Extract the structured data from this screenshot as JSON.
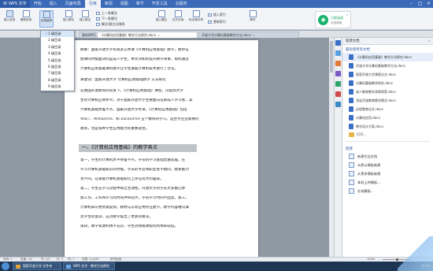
{
  "titlebar": {
    "app_name": "WPS 文字",
    "menus": [
      "开始",
      "插入",
      "页面布局",
      "引用",
      "审阅",
      "视图",
      "章节",
      "开发工具",
      "云服务"
    ],
    "active_menu": "引用"
  },
  "ribbon": {
    "buttons": [
      "插入目录",
      "更新目录",
      "目录级别",
      "插入脚注",
      "插入尾注",
      "插入题注",
      "交叉引用",
      "标记索引项",
      "邮件"
    ],
    "small_items": [
      "上一条脚注",
      "下一条脚注",
      "脚注/尾注分隔线",
      "插入索引",
      "更新索引"
    ],
    "wifi": {
      "title": "已经连接",
      "subtitle": "无线网络"
    }
  },
  "dropdown": {
    "items": [
      "1 级目录",
      "2 级目录",
      "3 级目录",
      "4 级目录",
      "5 级目录",
      "6 级目录",
      "7 级目录",
      "8 级目录",
      "9 级目录"
    ],
    "checked": "1 级目录"
  },
  "tabs": [
    {
      "label": "我的WPS"
    },
    {
      "label": "《计算机应用基础》教学方法探究.docx"
    },
    {
      "label": "开放大学计算机基础教学方法.docx"
    }
  ],
  "document": {
    "lines": [
      "摘要：国家开放大学有很多公共课《计算机应用基础》教学，教师在",
      "授课的时候面对的是成人学生，本文对如何提升教学效果，如何通过",
      "计算机应用基础课的教学让学生掌握计算机技术进行了讨论。",
      "关键词：国家开放大学 计算机应用基础教学 方法探究",
      "在我国开放教育的背景下，《计算机应用基础》课程，以提高大学",
      "生的计算机应用水平。对于国家开放大学主要面向在职成人学习者，其",
      "计算机基础参差不齐。国家开放大学考试，《计算机应用基础》包括",
      "Win7、Word2010、和 Excel2010 五个模块的学习，是合乎企业需要的",
      "教育，也是培养学生应用能力的重要途径。"
    ],
    "heading": "一、《计算机应用基础》的教学难点",
    "lines2": [
      "第一，学生的计算机水平参差不齐。学员的学习基础普遍较差，在",
      "学习计算机基础知识的时候，学员的专业和职业各不相同，接受能力",
      "也不同，在掌握计算机基础知识上存在较大的差异。",
      "第二，学生在学习过程中缺乏主动性。开放大学的学员大多都已参",
      "加工作，工作和学习的时间冲突较大，学员学习时间不固定。第三，",
      "计算机知识更新速度快，教材与实际应用存在脱节，教学内容难以满",
      "足学生的需求，这对教学提出了更高的要求。",
      "第四，教学资源利用不充分，学生对网络课程的利用率较低。"
    ]
  },
  "panel": {
    "title": "新建文档",
    "recent_section": "最近使用的文档",
    "recent_files": [
      "《计算机应用基础》教学方法探究.docx",
      "开放大学计算机基础教学方法.docx",
      "国家开放大学课程论文.docx",
      "计算机基础教学研究.docx",
      "成人教育教学改革探索.docx",
      "浅谈开放教育教学模式.docx",
      "远程教育论文.docx",
      "计算机应用.docx",
      "教学设计方案.docx"
    ],
    "open_label": "打开...",
    "new_section": "新建",
    "new_items": [
      "新建空白文档",
      "从默认模板新建",
      "从更多模板新建",
      "本机上的模板...",
      "在线模板..."
    ]
  },
  "statusbar": {
    "page": "页码: 1",
    "pages": "页面: 1/2",
    "section": "节: 1/1",
    "row": "行: 1",
    "col": "列: 1",
    "words": "字数: 1/1097",
    "spell": "拼写检查",
    "zoom": "100%"
  },
  "taskbar": {
    "buttons": [
      "国家开放大学 文件夹",
      "WPS 文字 - 教学方法探究"
    ],
    "time": "10:30"
  },
  "colors": {
    "titlebar": "#3a6ab8",
    "ribbon": "#f2f4f7",
    "wifi": "#18b36b",
    "taskbar": "#1d3552"
  }
}
